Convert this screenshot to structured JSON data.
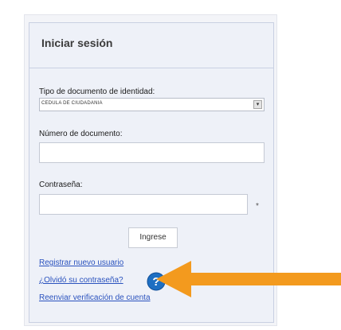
{
  "login": {
    "title": "Iniciar sesión",
    "doc_type_label": "Tipo de documento de identidad:",
    "doc_type_selected": "CEDULA DE CIUDADANIA",
    "doc_number_label": "Número de documento:",
    "doc_number_value": "",
    "password_label": "Contraseña:",
    "password_value": "",
    "required_mark": "*",
    "submit_label": "Ingrese"
  },
  "links": {
    "register": "Registrar nuevo usuario",
    "forgot_password": "¿Olvidó su contraseña?",
    "resend_verification": "Reenviar verificación de cuenta"
  },
  "help": {
    "glyph": "?"
  },
  "colors": {
    "accent_arrow": "#f39a1e",
    "link": "#2a52be",
    "help_icon": "#1e6fc2",
    "card_background": "#eef1f8"
  },
  "icons": {
    "select_arrow": "chevron-down-icon",
    "help": "help-icon",
    "annotation": "arrow-left-icon"
  }
}
